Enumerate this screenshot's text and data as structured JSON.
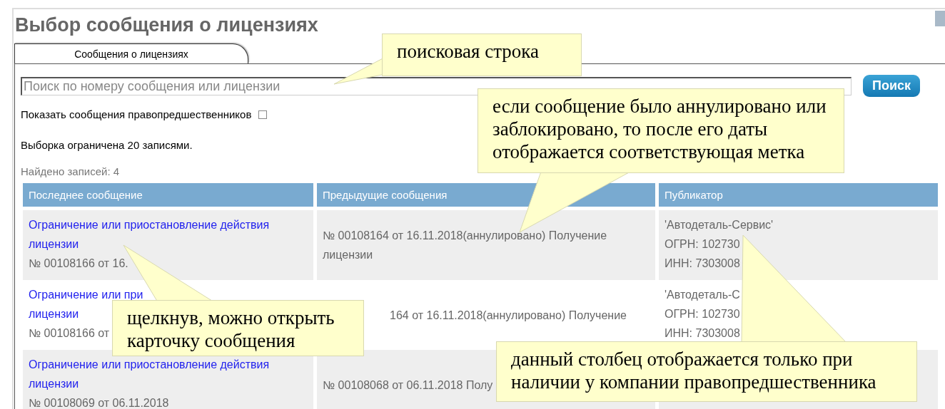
{
  "dialog": {
    "title": "Выбор сообщения о лицензиях"
  },
  "tabs": [
    {
      "label": "Сообщения о лицензиях",
      "selected": true
    }
  ],
  "search": {
    "placeholder": "Поиск по номеру сообщения или лицензии",
    "button": "Поиск"
  },
  "predecessors_option": {
    "label": "Показать сообщения правопредшественников",
    "checked": false
  },
  "limit_note": "Выборка ограничена 20 записями.",
  "found_count": "Найдено записей: 4",
  "table": {
    "columns": [
      "Последнее сообщение",
      "Предыдущие сообщения",
      "Публикатор"
    ],
    "rows": [
      {
        "last_message": {
          "title_lines": [
            "Ограничение или приостановление действия",
            "лицензии"
          ],
          "number": "№ 00108166 от 16."
        },
        "previous_messages": {
          "lines": [
            "№ 00108164 от 16.11.2018(аннулировано) Получение",
            "лицензии"
          ],
          "start_hidden": false
        },
        "publisher": [
          "'Автодеталь-Сервис'",
          "ОГРН: 102730",
          "ИНН: 7303008"
        ]
      },
      {
        "last_message": {
          "title_lines": [
            "Ограничение или при",
            "лицензии"
          ],
          "number": "№ 00108166 от"
        },
        "previous_messages": {
          "lines": [
            "164 от 16.11.2018(аннулировано) Получение"
          ],
          "start_hidden": true
        },
        "publisher": [
          "'Автодеталь-С",
          "ОГРН: 102730",
          "ИНН: 7303008"
        ]
      },
      {
        "last_message": {
          "title_lines": [
            "Ограничение или приостановление действия",
            "лицензии"
          ],
          "number": "№ 00108069 от 06.11.2018"
        },
        "previous_messages": {
          "lines": [
            "№ 00108068 от 06.11.2018 Полу"
          ],
          "start_hidden": false
        },
        "publisher": []
      }
    ]
  },
  "callouts": [
    {
      "text": "поисковая строка"
    },
    {
      "text": "если сообщение было аннулировано или заблокировано, то после его даты отображается соответствующая метка"
    },
    {
      "text": "щелкнув, можно открыть карточку сообщения"
    },
    {
      "text": "данный столбец отображается только при наличии у компании правопредшественника"
    }
  ]
}
